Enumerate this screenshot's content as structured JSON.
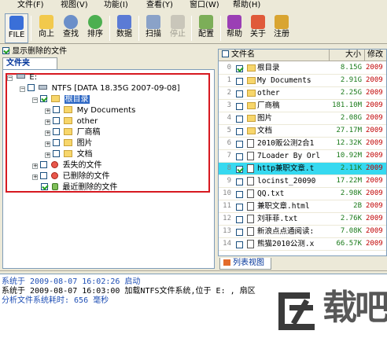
{
  "menu": {
    "items": [
      "文件(F)",
      "视图(V)",
      "功能(I)",
      "查看(Y)",
      "窗口(W)",
      "帮助(H)"
    ]
  },
  "toolbar": {
    "buttons": [
      {
        "label": "FILE",
        "icon": "file-icon",
        "state": "pressed"
      },
      {
        "label": "向上",
        "icon": "up-folder-icon"
      },
      {
        "label": "查找",
        "icon": "find-icon"
      },
      {
        "label": "排序",
        "icon": "sort-icon"
      },
      {
        "label": "数据",
        "icon": "data-icon"
      },
      {
        "label": "扫描",
        "icon": "scan-icon"
      },
      {
        "label": "停止",
        "icon": "stop-icon",
        "state": "disabled"
      },
      {
        "label": "配置",
        "icon": "config-icon"
      },
      {
        "label": "帮助",
        "icon": "help-book-icon"
      },
      {
        "label": "关于",
        "icon": "about-house-icon"
      },
      {
        "label": "注册",
        "icon": "register-key-icon"
      }
    ]
  },
  "left": {
    "show_deleted_label": "显示删除的文件",
    "show_deleted_checked": true,
    "tab_label": "文件夹",
    "tree": {
      "drive": "E:",
      "volume": "NTFS [DATA 18.35G 2007-09-08]",
      "root": "根目录",
      "children": [
        "My Documents",
        "other",
        "厂商稿",
        "图片",
        "文档"
      ],
      "lost_files": "丢失的文件",
      "deleted_files": "已删除的文件",
      "recent_deleted": "最近删除的文件"
    }
  },
  "right": {
    "columns": [
      "文件名",
      "大小",
      "修改"
    ],
    "rows": [
      {
        "idx": "0",
        "name": "根目录",
        "size": "8.15G",
        "date": "2009",
        "kind": "folder",
        "checked": true
      },
      {
        "idx": "1",
        "name": "My Documents",
        "size": "2.91G",
        "date": "2009",
        "kind": "folder",
        "checked": false
      },
      {
        "idx": "2",
        "name": "other",
        "size": "2.25G",
        "date": "2009",
        "kind": "folder",
        "checked": false
      },
      {
        "idx": "3",
        "name": "厂商稿",
        "size": "181.10M",
        "date": "2009",
        "kind": "folder",
        "checked": false
      },
      {
        "idx": "4",
        "name": "图片",
        "size": "2.08G",
        "date": "2009",
        "kind": "folder",
        "checked": false
      },
      {
        "idx": "5",
        "name": "文档",
        "size": "27.17M",
        "date": "2009",
        "kind": "folder",
        "checked": false
      },
      {
        "idx": "6",
        "name": "2010贩公测2合1",
        "size": "12.32K",
        "date": "2009",
        "kind": "file",
        "checked": false
      },
      {
        "idx": "7",
        "name": "7Loader By Orl",
        "size": "10.92M",
        "date": "2009",
        "kind": "file",
        "checked": false
      },
      {
        "idx": "8",
        "name": "http兼职文章.t",
        "size": "2.11K",
        "date": "2009",
        "kind": "file",
        "checked": true,
        "selected": true
      },
      {
        "idx": "9",
        "name": "locinst_20090",
        "size": "17.22M",
        "date": "2009",
        "kind": "file",
        "checked": false
      },
      {
        "idx": "10",
        "name": "QQ.txt",
        "size": "2.98K",
        "date": "2009",
        "kind": "file",
        "checked": false
      },
      {
        "idx": "11",
        "name": "兼职文章.html",
        "size": "2B",
        "date": "2009",
        "kind": "file",
        "checked": false
      },
      {
        "idx": "12",
        "name": "刘菲菲.txt",
        "size": "2.76K",
        "date": "2009",
        "kind": "file",
        "checked": false
      },
      {
        "idx": "13",
        "name": "新浪点点通阅读:",
        "size": "7.08K",
        "date": "2009",
        "kind": "file",
        "checked": false
      },
      {
        "idx": "14",
        "name": "熊猫2010公测.x",
        "size": "66.57K",
        "date": "2009",
        "kind": "file",
        "checked": false
      }
    ],
    "tab_label": "列表视图"
  },
  "log": {
    "lines": [
      {
        "text": "系统于  2009-08-07 16:02:26 启动",
        "tone": "blue"
      },
      {
        "text": "系统于  2009-08-07 16:03:00 加载NTFS文件系统,位于 E: ,   扇区",
        "tone": "black"
      },
      {
        "text": "分析文件系统耗时: 656 毫秒",
        "tone": "blue"
      }
    ]
  },
  "watermark": {
    "text": "载吧"
  },
  "colors": {
    "selection": "#36d9f0",
    "size_text": "#1a7a1a",
    "date_text": "#c00000",
    "highlight_box": "#d71920",
    "log_text": "#1f4fb5"
  }
}
